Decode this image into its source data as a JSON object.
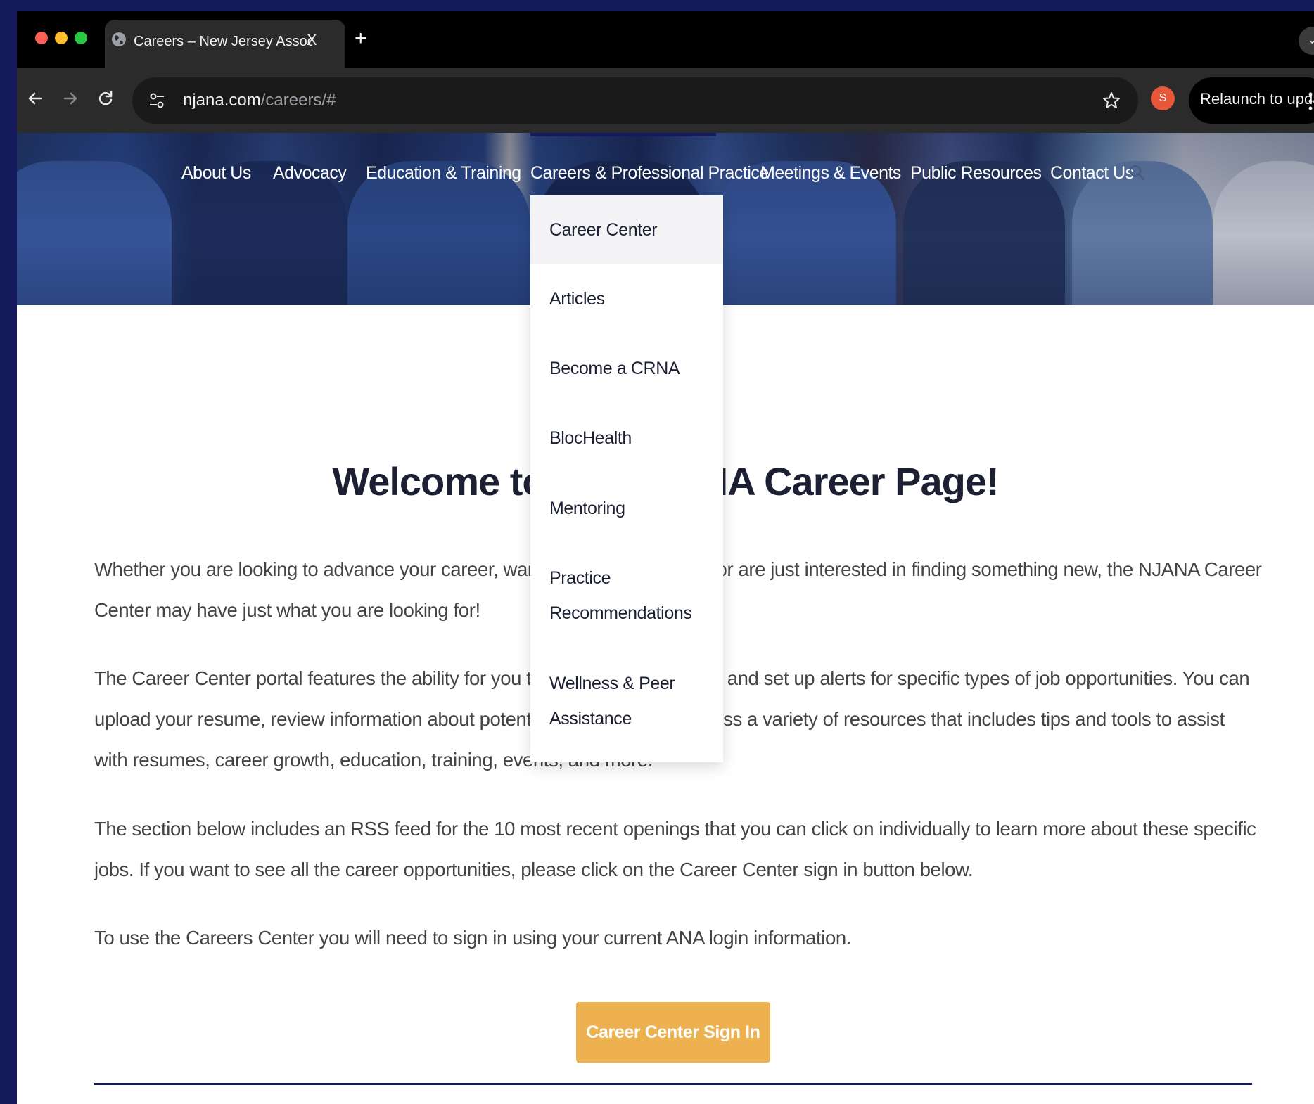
{
  "browser": {
    "tab_title": "Careers – New Jersey Association of Nurse Anesthetists",
    "tab_close": "X",
    "new_tab": "+",
    "url_host": "njana.com",
    "url_path": "/careers/#",
    "profile_initial": "S",
    "relaunch_label": "Relaunch to update"
  },
  "nav": {
    "items": [
      {
        "label": "About Us"
      },
      {
        "label": "Advocacy"
      },
      {
        "label": "Education & Training"
      },
      {
        "label": "Careers & Professional Practice"
      },
      {
        "label": "Meetings & Events"
      },
      {
        "label": "Public Resources"
      },
      {
        "label": "Contact Us"
      }
    ]
  },
  "dropdown": {
    "items": [
      {
        "label": "Career Center"
      },
      {
        "label": "Articles"
      },
      {
        "label": "Become a CRNA"
      },
      {
        "label": "BlocHealth"
      },
      {
        "label": "Mentoring"
      },
      {
        "label": "Practice Recommendations"
      },
      {
        "label": "Wellness & Peer Assistance"
      }
    ]
  },
  "page": {
    "title": "Welcome to the NJANA Career Page!",
    "paragraphs": [
      "Whether you are looking to advance your career, want a job in a new area, or are just interested in finding something new, the NJANA Career Center may have just what you are looking for!",
      "The Career Center portal features the ability for you to see current openings and set up alerts for specific types of job opportunities. You can upload your resume, review information about potential employers and access a variety of resources that includes tips and tools to assist with resumes, career growth, education, training, events, and more.",
      "The section below includes an RSS feed for the 10 most recent openings that you can click on individually to learn more about these specific jobs. If you want to see all the career opportunities, please click on the Career Center sign in button below.",
      "To use the Careers Center you will need to sign in using your current ANA login information."
    ],
    "signin_label": "Career Center Sign In"
  },
  "colors": {
    "brand_navy": "#141a5c",
    "button_gold": "#edb14f"
  },
  "icons": {
    "back": "back-arrow-icon",
    "forward": "forward-arrow-icon",
    "reload": "reload-icon",
    "site_settings": "tune-icon",
    "bookmark": "star-icon",
    "search": "search-icon",
    "tab_favicon": "globe-icon"
  }
}
